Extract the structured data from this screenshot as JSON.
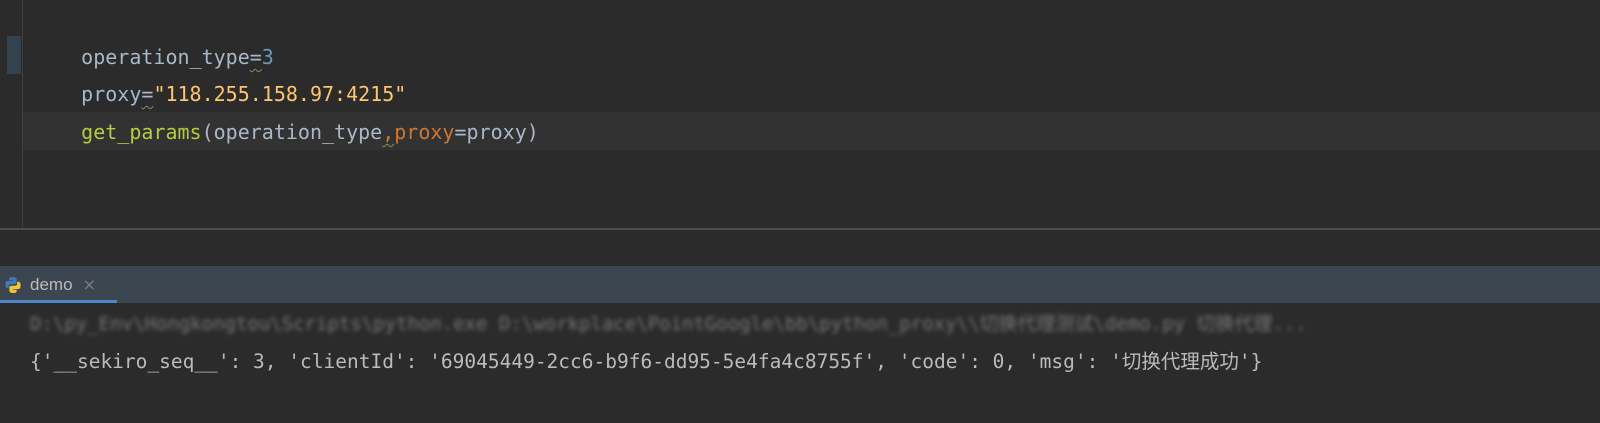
{
  "editor": {
    "lines": [
      {
        "var": "operation_type",
        "eq": "=",
        "value": "3"
      },
      {
        "var": "proxy",
        "eq": "=",
        "value": "\"118.255.158.97:4215\""
      },
      {
        "fn": "get_params",
        "open": "(",
        "arg1": "operation_type",
        "comma": ",",
        "kwarg": "proxy",
        "kweq": "=",
        "kwval": "proxy",
        "close": ")"
      }
    ]
  },
  "run_panel": {
    "tab_label": "demo",
    "tab_close_glyph": "×",
    "icon": "python-icon",
    "console": {
      "command_line": "D:\\py_Env\\Hongkongtou\\Scripts\\python.exe D:\\workplace\\PointGoogle\\bb\\python_proxy\\\\切换代理测试\\demo.py 切换代理...  ",
      "output": "{'__sekiro_seq__': 3, 'clientId': '69045449-2cc6-b9f6-dd95-5e4fa4c8755f', 'code': 0, 'msg': '",
      "output_cjk": "切换代理成功",
      "output_end": "'}"
    }
  },
  "colors": {
    "editor_bg": "#2b2b2b",
    "number": "#6897bb",
    "string": "#ffc66d",
    "function": "#b5cc40",
    "keyword_arg": "#cc7832",
    "text": "#a9b7c6",
    "tab_underline": "#4a88c7"
  }
}
